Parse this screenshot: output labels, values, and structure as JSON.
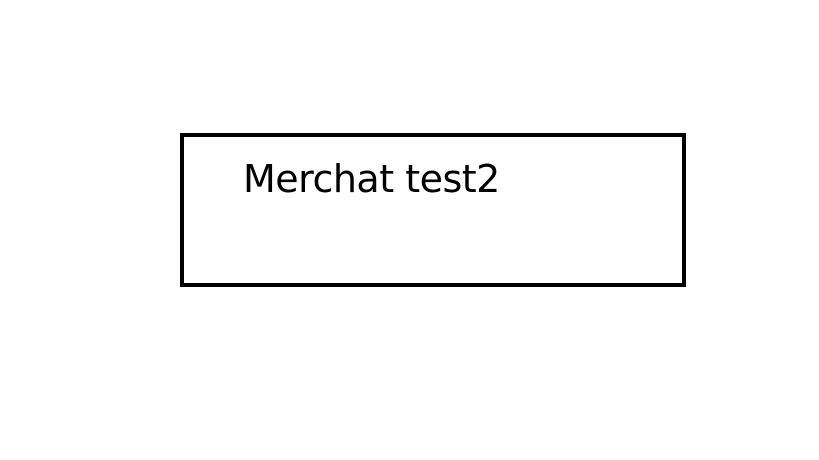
{
  "box": {
    "label": "Merchat test2"
  },
  "colors": {
    "background": "#ffffff",
    "border": "#000000",
    "text": "#000000"
  }
}
